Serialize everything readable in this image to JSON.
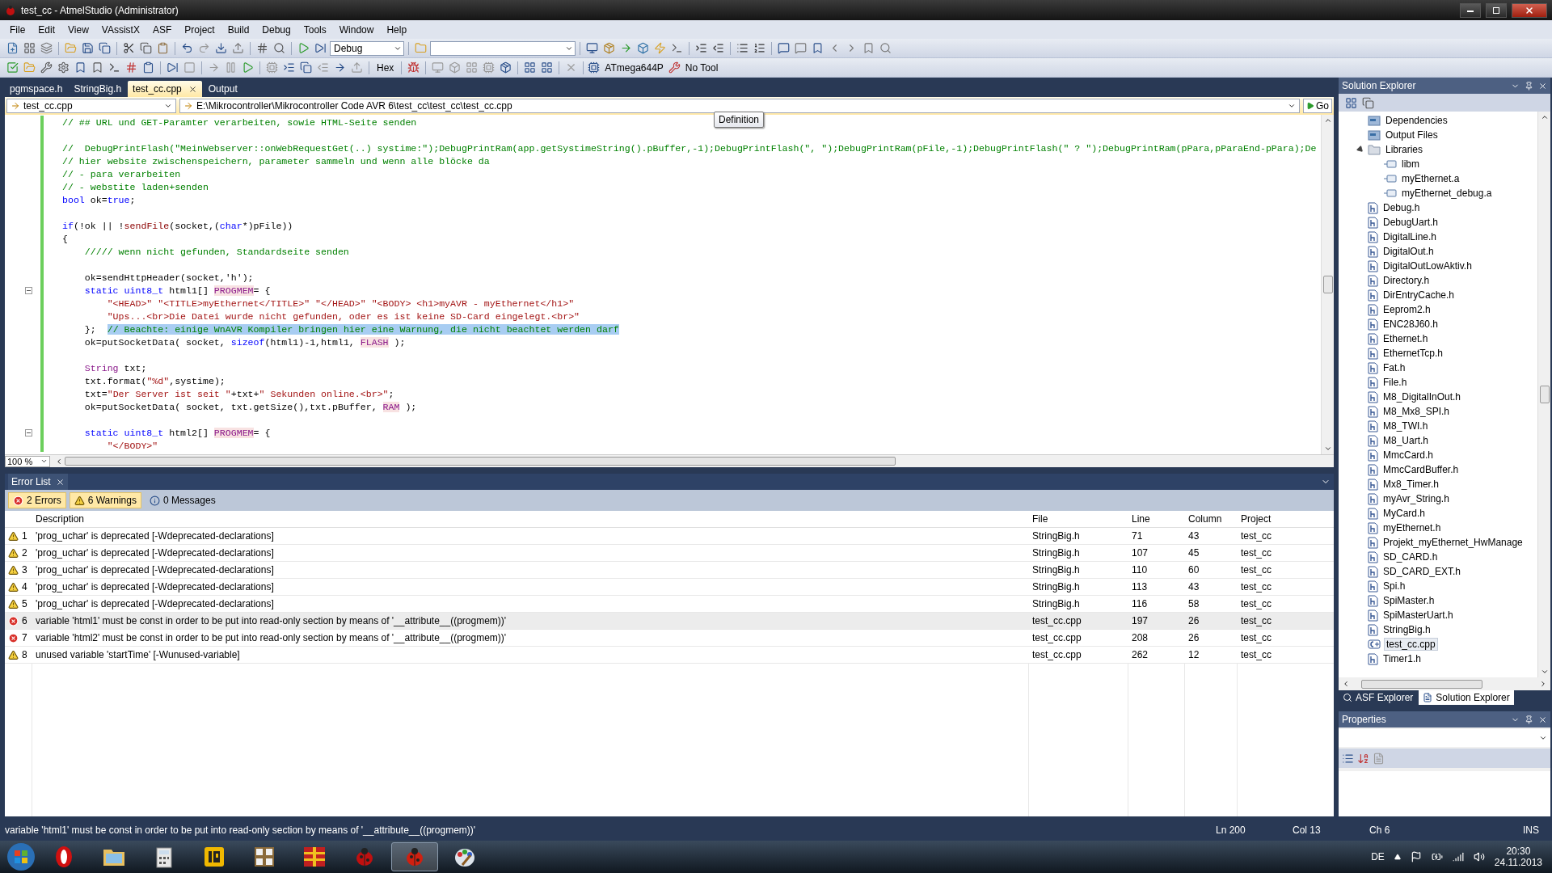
{
  "window": {
    "title": "test_cc - AtmelStudio (Administrator)"
  },
  "menu": [
    "File",
    "Edit",
    "View",
    "VAssistX",
    "ASF",
    "Project",
    "Build",
    "Debug",
    "Tools",
    "Window",
    "Help"
  ],
  "toolbar": {
    "configuration": "Debug",
    "hex_label": "Hex",
    "device": "ATmega644P",
    "tool": "No Tool"
  },
  "doc_tabs": [
    {
      "label": "pgmspace.h",
      "selected": false
    },
    {
      "label": "StringBig.h",
      "selected": false
    },
    {
      "label": "test_cc.cpp",
      "selected": true
    },
    {
      "label": "Output",
      "selected": false
    }
  ],
  "nav_bar": {
    "file": "test_cc.cpp",
    "path": "E:\\Mikrocontroller\\Mikrocontroller Code AVR 6\\test_cc\\test_cc\\test_cc.cpp",
    "go": "Go"
  },
  "tooltip": "Definition",
  "editor": {
    "zoom": "100 %",
    "lines": [
      {
        "fold": false,
        "tokens": [
          {
            "kind": "comment",
            "t": "// ## URL und GET-Paramter verarbeiten, sowie HTML-Seite senden"
          }
        ]
      },
      {
        "fold": false
      },
      {
        "fold": false,
        "tokens": [
          {
            "kind": "comment",
            "t": "//  DebugPrintFlash(\"MeinWebserver::onWebRequestGet(..) systime:\");DebugPrintRam(app.getSystimeString().pBuffer,-1);DebugPrintFlash(\", \");DebugPrintRam(pFile,-1);DebugPrintFlash(\" ? \");DebugPrintRam(pPara,pParaEnd-pPara);De"
          }
        ]
      },
      {
        "fold": false,
        "tokens": [
          {
            "kind": "comment",
            "t": "// hier website zwischenspeichern, parameter sammeln und wenn alle blöcke da"
          }
        ]
      },
      {
        "fold": false,
        "tokens": [
          {
            "kind": "comment",
            "t": "// - para verarbeiten"
          }
        ]
      },
      {
        "fold": false,
        "tokens": [
          {
            "kind": "comment",
            "t": "// - webstite laden+senden"
          }
        ]
      },
      {
        "fold": false,
        "tokens": [
          {
            "kind": "keyword",
            "t": "bool"
          },
          {
            "kind": "plain",
            "t": " ok="
          },
          {
            "kind": "keyword",
            "t": "true"
          },
          {
            "kind": "plain",
            "t": ";"
          }
        ]
      },
      {
        "fold": false
      },
      {
        "fold": false,
        "tokens": [
          {
            "kind": "keyword",
            "t": "if"
          },
          {
            "kind": "plain",
            "t": "(!ok || !"
          },
          {
            "kind": "function",
            "t": "sendFile"
          },
          {
            "kind": "plain",
            "t": "(socket,("
          },
          {
            "kind": "keyword",
            "t": "char"
          },
          {
            "kind": "plain",
            "t": "*)pFile))"
          }
        ]
      },
      {
        "fold": false,
        "tokens": [
          {
            "kind": "plain",
            "t": "{"
          }
        ]
      },
      {
        "fold": false,
        "tokens": [
          {
            "kind": "comment",
            "t": "    ///// wenn nicht gefunden, Standardseite senden"
          }
        ]
      },
      {
        "fold": false
      },
      {
        "fold": false,
        "tokens": [
          {
            "kind": "plain",
            "t": "    ok=sendHttpHeader(socket,'h');"
          }
        ]
      },
      {
        "fold": true,
        "tokens": [
          {
            "kind": "keyword",
            "t": "    static uint8_t"
          },
          {
            "kind": "plain",
            "t": " html1[] "
          },
          {
            "kind": "macro",
            "t": "PROGMEM"
          },
          {
            "kind": "plain",
            "t": "= {"
          }
        ]
      },
      {
        "fold": false,
        "tokens": [
          {
            "kind": "string",
            "t": "        \"<HEAD>\" \"<TITLE>myEthernet</TITLE>\" \"</HEAD>\" \"<BODY> <h1>myAVR - myEthernet</h1>\""
          }
        ]
      },
      {
        "fold": false,
        "tokens": [
          {
            "kind": "string",
            "t": "        \"Ups...<br>Die Datei wurde nicht gefunden, oder es ist keine SD-Card eingelegt.<br>\""
          }
        ]
      },
      {
        "fold": false,
        "tokens": [
          {
            "kind": "plain",
            "t": "    };  "
          },
          {
            "kind": "selection",
            "t": "// Beachte: einige WnAVR Kompiler bringen hier eine Warnung, die nicht beachtet werden darf"
          }
        ]
      },
      {
        "fold": false,
        "tokens": [
          {
            "kind": "plain",
            "t": "    ok=putSocketData( socket, "
          },
          {
            "kind": "keyword",
            "t": "sizeof"
          },
          {
            "kind": "plain",
            "t": "(html1)-1,html1, "
          },
          {
            "kind": "macro",
            "t": "FLASH"
          },
          {
            "kind": "plain",
            "t": " );"
          }
        ]
      },
      {
        "fold": false
      },
      {
        "fold": false,
        "tokens": [
          {
            "kind": "type",
            "t": "    String"
          },
          {
            "kind": "plain",
            "t": " txt;"
          }
        ]
      },
      {
        "fold": false,
        "tokens": [
          {
            "kind": "plain",
            "t": "    txt.format("
          },
          {
            "kind": "string",
            "t": "\"%d\""
          },
          {
            "kind": "plain",
            "t": ",systime);"
          }
        ]
      },
      {
        "fold": false,
        "tokens": [
          {
            "kind": "plain",
            "t": "    txt="
          },
          {
            "kind": "string",
            "t": "\"Der Server ist seit \""
          },
          {
            "kind": "plain",
            "t": "+txt+"
          },
          {
            "kind": "string",
            "t": "\" Sekunden online.<br>\""
          },
          {
            "kind": "plain",
            "t": ";"
          }
        ]
      },
      {
        "fold": false,
        "tokens": [
          {
            "kind": "plain",
            "t": "    ok=putSocketData( socket, txt.getSize(),txt.pBuffer, "
          },
          {
            "kind": "macro",
            "t": "RAM"
          },
          {
            "kind": "plain",
            "t": " );"
          }
        ]
      },
      {
        "fold": false
      },
      {
        "fold": true,
        "tokens": [
          {
            "kind": "keyword",
            "t": "    static uint8_t"
          },
          {
            "kind": "plain",
            "t": " html2[] "
          },
          {
            "kind": "macro",
            "t": "PROGMEM"
          },
          {
            "kind": "plain",
            "t": "= {"
          }
        ]
      },
      {
        "fold": false,
        "tokens": [
          {
            "kind": "string",
            "t": "        \"</BODY>\""
          }
        ]
      }
    ]
  },
  "error_list": {
    "title": "Error List",
    "filters": [
      {
        "kind": "error",
        "label": "2 Errors",
        "selected": true
      },
      {
        "kind": "warning",
        "label": "6 Warnings",
        "selected": true
      },
      {
        "kind": "message",
        "label": "0 Messages",
        "selected": false
      }
    ],
    "columns": [
      "Description",
      "File",
      "Line",
      "Column",
      "Project"
    ],
    "rows": [
      {
        "kind": "warning",
        "number": "1",
        "description": "'prog_uchar' is deprecated [-Wdeprecated-declarations]",
        "file": "StringBig.h",
        "line": "71",
        "column": "43",
        "project": "test_cc",
        "selected": false
      },
      {
        "kind": "warning",
        "number": "2",
        "description": "'prog_uchar' is deprecated [-Wdeprecated-declarations]",
        "file": "StringBig.h",
        "line": "107",
        "column": "45",
        "project": "test_cc",
        "selected": false
      },
      {
        "kind": "warning",
        "number": "3",
        "description": "'prog_uchar' is deprecated [-Wdeprecated-declarations]",
        "file": "StringBig.h",
        "line": "110",
        "column": "60",
        "project": "test_cc",
        "selected": false
      },
      {
        "kind": "warning",
        "number": "4",
        "description": "'prog_uchar' is deprecated [-Wdeprecated-declarations]",
        "file": "StringBig.h",
        "line": "113",
        "column": "43",
        "project": "test_cc",
        "selected": false
      },
      {
        "kind": "warning",
        "number": "5",
        "description": "'prog_uchar' is deprecated [-Wdeprecated-declarations]",
        "file": "StringBig.h",
        "line": "116",
        "column": "58",
        "project": "test_cc",
        "selected": false
      },
      {
        "kind": "error",
        "number": "6",
        "description": "variable 'html1' must be const in order to be put into read-only section by means of '__attribute__((progmem))'",
        "file": "test_cc.cpp",
        "line": "197",
        "column": "26",
        "project": "test_cc",
        "selected": true
      },
      {
        "kind": "error",
        "number": "7",
        "description": "variable 'html2' must be const in order to be put into read-only section by means of '__attribute__((progmem))'",
        "file": "test_cc.cpp",
        "line": "208",
        "column": "26",
        "project": "test_cc",
        "selected": false
      },
      {
        "kind": "warning",
        "number": "8",
        "description": "unused variable 'startTime' [-Wunused-variable]",
        "file": "test_cc.cpp",
        "line": "262",
        "column": "12",
        "project": "test_cc",
        "selected": false
      }
    ]
  },
  "solution_explorer": {
    "title": "Solution Explorer",
    "items": [
      {
        "kind": "folder",
        "label": "Dependencies",
        "selected": false
      },
      {
        "kind": "folder",
        "label": "Output Files",
        "selected": false
      },
      {
        "kind": "open-folder",
        "label": "Libraries",
        "selected": false,
        "expanded": true,
        "children": [
          {
            "kind": "library",
            "label": "libm",
            "selected": false
          },
          {
            "kind": "library",
            "label": "myEthernet.a",
            "selected": false
          },
          {
            "kind": "library",
            "label": "myEthernet_debug.a",
            "selected": false
          }
        ]
      },
      {
        "kind": "header",
        "label": "Debug.h",
        "selected": false
      },
      {
        "kind": "header",
        "label": "DebugUart.h",
        "selected": false
      },
      {
        "kind": "header",
        "label": "DigitalLine.h",
        "selected": false
      },
      {
        "kind": "header",
        "label": "DigitalOut.h",
        "selected": false
      },
      {
        "kind": "header",
        "label": "DigitalOutLowAktiv.h",
        "selected": false
      },
      {
        "kind": "header",
        "label": "Directory.h",
        "selected": false
      },
      {
        "kind": "header",
        "label": "DirEntryCache.h",
        "selected": false
      },
      {
        "kind": "header",
        "label": "Eeprom2.h",
        "selected": false
      },
      {
        "kind": "header",
        "label": "ENC28J60.h",
        "selected": false
      },
      {
        "kind": "header",
        "label": "Ethernet.h",
        "selected": false
      },
      {
        "kind": "header",
        "label": "EthernetTcp.h",
        "selected": false
      },
      {
        "kind": "header",
        "label": "Fat.h",
        "selected": false
      },
      {
        "kind": "header",
        "label": "File.h",
        "selected": false
      },
      {
        "kind": "header",
        "label": "M8_DigitalInOut.h",
        "selected": false
      },
      {
        "kind": "header",
        "label": "M8_Mx8_SPI.h",
        "selected": false
      },
      {
        "kind": "header",
        "label": "M8_TWI.h",
        "selected": false
      },
      {
        "kind": "header",
        "label": "M8_Uart.h",
        "selected": false
      },
      {
        "kind": "header",
        "label": "MmcCard.h",
        "selected": false
      },
      {
        "kind": "header",
        "label": "MmcCardBuffer.h",
        "selected": false
      },
      {
        "kind": "header",
        "label": "Mx8_Timer.h",
        "selected": false
      },
      {
        "kind": "header",
        "label": "myAvr_String.h",
        "selected": false
      },
      {
        "kind": "header",
        "label": "MyCard.h",
        "selected": false
      },
      {
        "kind": "header",
        "label": "myEthernet.h",
        "selected": false
      },
      {
        "kind": "header",
        "label": "Projekt_myEthernet_HwManage",
        "selected": false
      },
      {
        "kind": "header",
        "label": "SD_CARD.h",
        "selected": false
      },
      {
        "kind": "header",
        "label": "SD_CARD_EXT.h",
        "selected": false
      },
      {
        "kind": "header",
        "label": "Spi.h",
        "selected": false
      },
      {
        "kind": "header",
        "label": "SpiMaster.h",
        "selected": false
      },
      {
        "kind": "header",
        "label": "SpiMasterUart.h",
        "selected": false
      },
      {
        "kind": "header",
        "label": "StringBig.h",
        "selected": false
      },
      {
        "kind": "cpp",
        "label": "test_cc.cpp",
        "selected": true
      },
      {
        "kind": "header",
        "label": "Timer1.h",
        "selected": false
      }
    ],
    "tabs": [
      {
        "label": "ASF Explorer",
        "selected": false
      },
      {
        "label": "Solution Explorer",
        "selected": true
      }
    ]
  },
  "properties": {
    "title": "Properties"
  },
  "status_bar": {
    "message": "variable 'html1' must be const in order to be put into read-only section by means of '__attribute__((progmem))'",
    "ln": "Ln 200",
    "col": "Col 13",
    "ch": "Ch 6",
    "mode": "INS"
  },
  "taskbar": {
    "language": "DE",
    "time": "20:30",
    "date": "24.11.2013"
  }
}
